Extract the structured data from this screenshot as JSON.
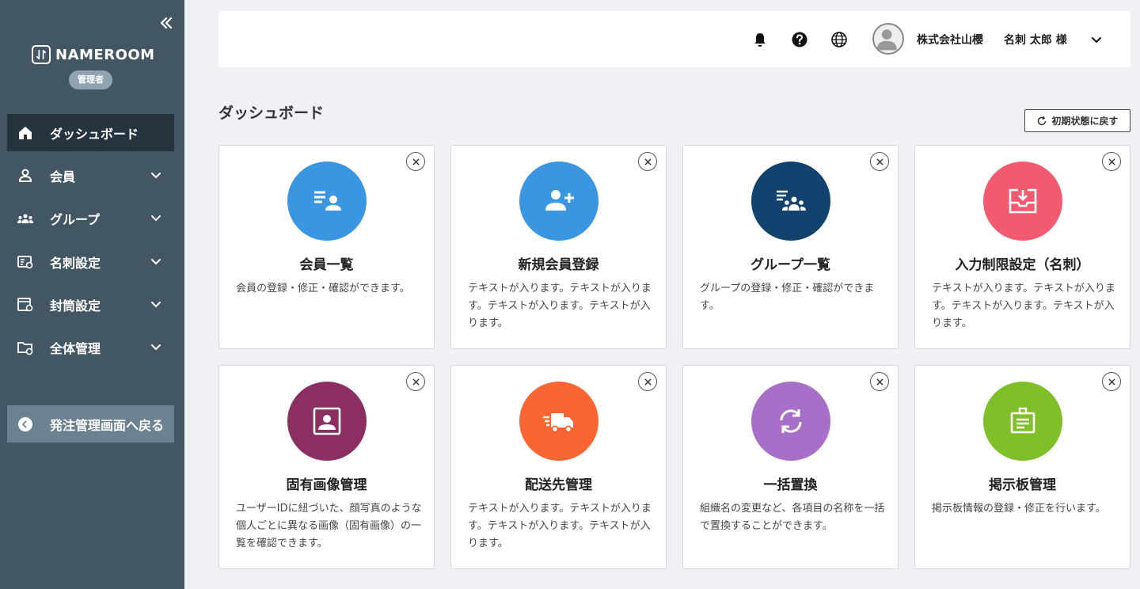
{
  "sidebar": {
    "brand": "NAMEROOM",
    "role": "管理者",
    "items": [
      {
        "label": "ダッシュボード"
      },
      {
        "label": "会員"
      },
      {
        "label": "グループ"
      },
      {
        "label": "名刺設定"
      },
      {
        "label": "封筒設定"
      },
      {
        "label": "全体管理"
      }
    ],
    "back_label": "発注管理画面へ戻る"
  },
  "header": {
    "company": "株式会社山櫻",
    "user": "名刺 太郎 様"
  },
  "main": {
    "title": "ダッシュボード",
    "reset_label": "初期状態に戻す",
    "cards": [
      {
        "title": "会員一覧",
        "desc": "会員の登録・修正・確認ができます。",
        "color": "#3a96e0",
        "icon": "member-list-icon"
      },
      {
        "title": "新規会員登録",
        "desc": "テキストが入ります。テキストが入ります。テキストが入ります。テキストが入ります。",
        "color": "#3a96e0",
        "icon": "add-member-icon"
      },
      {
        "title": "グループ一覧",
        "desc": "グループの登録・修正・確認ができます。",
        "color": "#12436e",
        "icon": "group-list-icon"
      },
      {
        "title": "入力制限設定（名刺）",
        "desc": "テキストが入ります。テキストが入ります。テキストが入ります。テキストが入ります。",
        "color": "#f25a70",
        "icon": "input-restriction-icon"
      },
      {
        "title": "固有画像管理",
        "desc": "ユーザーIDに紐づいた、顔写真のような個人ごとに異なる画像（固有画像）の一覧を確認できます。",
        "color": "#8b2e62",
        "icon": "portrait-icon"
      },
      {
        "title": "配送先管理",
        "desc": "テキストが入ります。テキストが入ります。テキストが入ります。テキストが入ります。",
        "color": "#fa6633",
        "icon": "delivery-truck-icon"
      },
      {
        "title": "一括置換",
        "desc": "組織名の変更など、各項目の名称を一括で置換することができます。",
        "color": "#a86fc9",
        "icon": "replace-icon"
      },
      {
        "title": "掲示板管理",
        "desc": "掲示板情報の登録・修正を行います。",
        "color": "#7fbf2a",
        "icon": "bulletin-board-icon"
      }
    ]
  }
}
